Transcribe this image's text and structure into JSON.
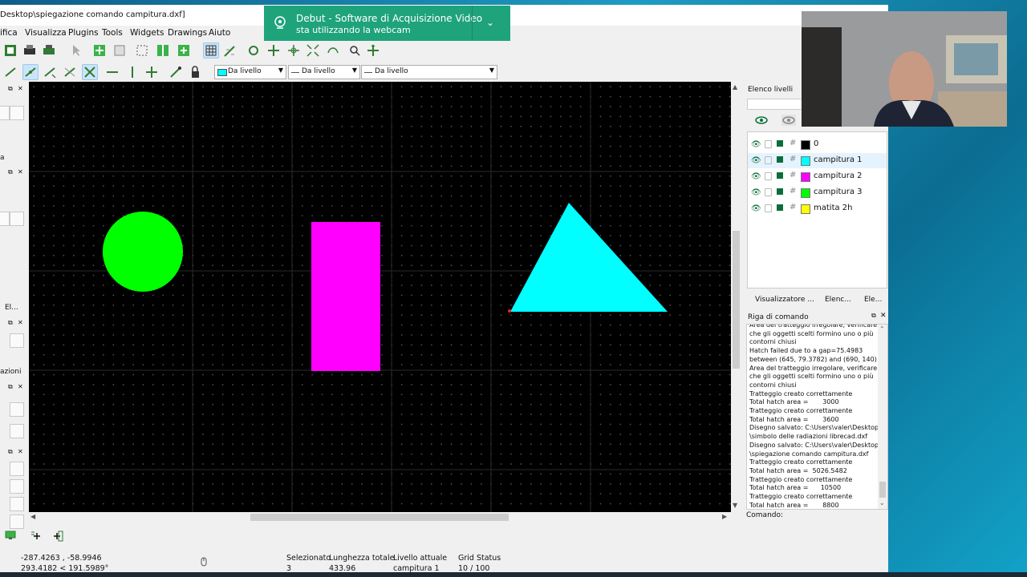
{
  "window": {
    "title": "Desktop\\spiegazione comando campitura.dxf]"
  },
  "menu": [
    "ifica",
    "Visualizza",
    "Plugins",
    "Tools",
    "Widgets",
    "Drawings",
    "Aiuto"
  ],
  "toolbar2": {
    "pen_color": "Da livello",
    "line_type": "Da livello",
    "line_width": "Da livello"
  },
  "left_dock": {
    "cut_labels": [
      "a",
      "El...",
      "azioni"
    ]
  },
  "canvas": {
    "shapes": [
      {
        "name": "circle",
        "color": "#00ff00"
      },
      {
        "name": "rectangle",
        "color": "#ff00ff"
      },
      {
        "name": "triangle",
        "color": "#00ffff"
      }
    ]
  },
  "layer_panel": {
    "title": "Elenco livelli",
    "layers": [
      {
        "name": "0",
        "color": "#000000"
      },
      {
        "name": "campitura 1",
        "color": "#00ffff"
      },
      {
        "name": "campitura 2",
        "color": "#ff00ff"
      },
      {
        "name": "campitura 3",
        "color": "#00ff00"
      },
      {
        "name": "matita 2h",
        "color": "#ffff00"
      }
    ],
    "tabs": [
      "Visualizzatore ...",
      "Elenc...",
      "Ele..."
    ]
  },
  "command_panel": {
    "title": "Riga di comando",
    "log": [
      "Area del tratteggio irregolare, verificare",
      "che gli oggetti scelti formino uno o più",
      "contorni chiusi",
      "Hatch failed due to a gap=75.4983",
      "between (645, 79.3782) and (690, 140)",
      "Area del tratteggio irregolare, verificare",
      "che gli oggetti scelti formino uno o più",
      "contorni chiusi",
      "Tratteggio creato correttamente",
      "Total hatch area =       3000",
      "Tratteggio creato correttamente",
      "Total hatch area =       3600",
      "Disegno salvato: C:\\Users\\valer\\Desktop",
      "\\simbolo delle radiazioni librecad.dxf",
      "Disegno salvato: C:\\Users\\valer\\Desktop",
      "\\spiegazione comando campitura.dxf",
      "Tratteggio creato correttamente",
      "Total hatch area =  5026.5482",
      "Tratteggio creato correttamente",
      "Total hatch area =      10500",
      "Tratteggio creato correttamente",
      "Total hatch area =       8800"
    ],
    "input_label": "Comando:"
  },
  "status": {
    "coord_abs": "-287.4263 , -58.9946",
    "coord_polar": "293.4182 < 191.5989°",
    "selected_label": "Selezionato",
    "selected_value": "3",
    "length_label": "Lunghezza totale",
    "length_value": "433.96",
    "layer_label": "Livello attuale",
    "layer_value": "campitura 1",
    "grid_label": "Grid Status",
    "grid_value": "10 / 100"
  },
  "notification": {
    "title": "Debut - Software di Acquisizione Video",
    "subtitle": "sta utilizzando la webcam"
  }
}
